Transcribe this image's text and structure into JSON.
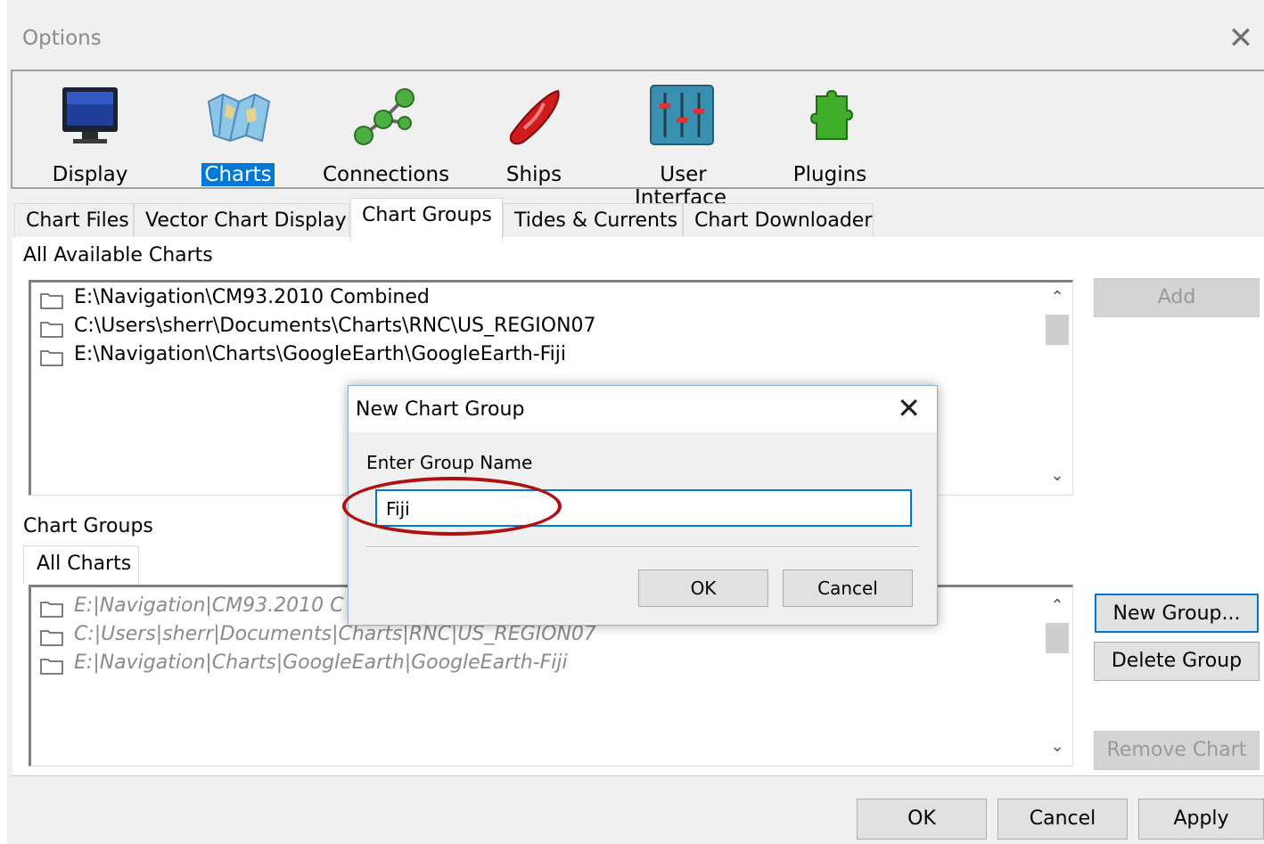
{
  "window": {
    "title": "Options"
  },
  "toolbar": {
    "items": [
      {
        "label": "Display",
        "icon": "monitor-icon"
      },
      {
        "label": "Charts",
        "icon": "map-icon",
        "selected": true
      },
      {
        "label": "Connections",
        "icon": "connections-icon"
      },
      {
        "label": "Ships",
        "icon": "ship-icon"
      },
      {
        "label": "User Interface",
        "icon": "sliders-icon"
      },
      {
        "label": "Plugins",
        "icon": "puzzle-piece-icon"
      }
    ]
  },
  "tabs": [
    {
      "label": "Chart Files"
    },
    {
      "label": "Vector Chart Display"
    },
    {
      "label": "Chart Groups",
      "active": true
    },
    {
      "label": "Tides & Currents"
    },
    {
      "label": "Chart Downloader"
    }
  ],
  "available": {
    "label": "All Available Charts",
    "items": [
      "E:\\Navigation\\CM93.2010 Combined",
      "C:\\Users\\sherr\\Documents\\Charts\\RNC\\US_REGION07",
      "E:\\Navigation\\Charts\\GoogleEarth\\GoogleEarth-Fiji"
    ],
    "add_label": "Add"
  },
  "groups": {
    "label": "Chart Groups",
    "tab_label": "All Charts",
    "items": [
      "E:|Navigation|CM93.2010 C",
      "C:|Users|sherr|Documents|Charts|RNC|US_REGION07",
      "E:|Navigation|Charts|GoogleEarth|GoogleEarth-Fiji"
    ],
    "new_group_label": "New Group...",
    "delete_group_label": "Delete Group",
    "remove_chart_label": "Remove Chart"
  },
  "footer": {
    "ok_label": "OK",
    "cancel_label": "Cancel",
    "apply_label": "Apply"
  },
  "dialog": {
    "title": "New Chart Group",
    "prompt": "Enter Group Name",
    "value": "Fiji",
    "ok_label": "OK",
    "cancel_label": "Cancel"
  },
  "colors": {
    "accent": "#0078d7",
    "highlight_ring": "#b01010"
  }
}
